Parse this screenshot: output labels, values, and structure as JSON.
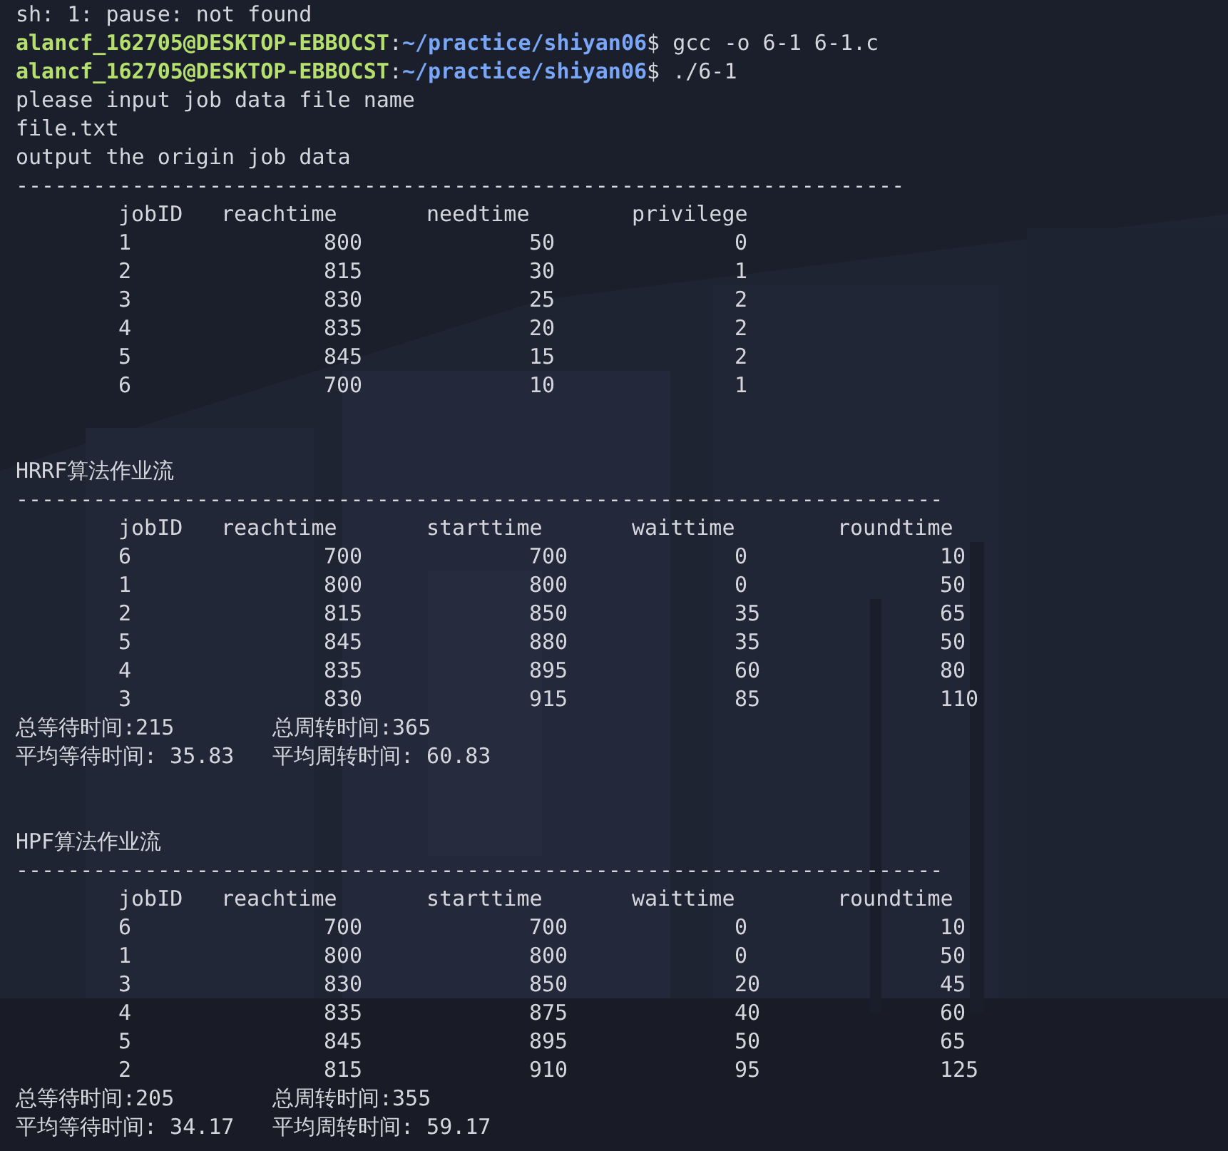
{
  "terminal": {
    "lines": [
      {
        "kind": "text",
        "text": "sh: 1: pause: not found"
      },
      {
        "kind": "prompt",
        "user": "alancf_162705@DESKTOP-EBBOCST",
        "sep": ":",
        "path": "~/practice/shiyan06",
        "command": "$ gcc -o 6-1 6-1.c"
      },
      {
        "kind": "prompt",
        "user": "alancf_162705@DESKTOP-EBBOCST",
        "sep": ":",
        "path": "~/practice/shiyan06",
        "command": "$ ./6-1"
      },
      {
        "kind": "text",
        "text": "please input job data file name"
      },
      {
        "kind": "text",
        "text": "file.txt"
      },
      {
        "kind": "text",
        "text": "output the origin job data"
      },
      {
        "kind": "rule",
        "text": "---------------------------------------------------------------------"
      },
      {
        "kind": "header",
        "cells": [
          "jobID",
          "reachtime",
          "needtime",
          "privilege"
        ]
      },
      {
        "kind": "row",
        "cells": [
          "1",
          "800",
          "50",
          "0"
        ]
      },
      {
        "kind": "row",
        "cells": [
          "2",
          "815",
          "30",
          "1"
        ]
      },
      {
        "kind": "row",
        "cells": [
          "3",
          "830",
          "25",
          "2"
        ]
      },
      {
        "kind": "row",
        "cells": [
          "4",
          "835",
          "20",
          "2"
        ]
      },
      {
        "kind": "row",
        "cells": [
          "5",
          "845",
          "15",
          "2"
        ]
      },
      {
        "kind": "row",
        "cells": [
          "6",
          "700",
          "10",
          "1"
        ]
      },
      {
        "kind": "blank"
      },
      {
        "kind": "blank"
      },
      {
        "kind": "text",
        "text": "HRRF算法作业流"
      },
      {
        "kind": "rule",
        "text": "------------------------------------------------------------------------"
      },
      {
        "kind": "header",
        "cells": [
          "jobID",
          "reachtime",
          "starttime",
          "waittime",
          "roundtime"
        ]
      },
      {
        "kind": "row",
        "cells": [
          "6",
          "700",
          "700",
          "0",
          "10"
        ]
      },
      {
        "kind": "row",
        "cells": [
          "1",
          "800",
          "800",
          "0",
          "50"
        ]
      },
      {
        "kind": "row",
        "cells": [
          "2",
          "815",
          "850",
          "35",
          "65"
        ]
      },
      {
        "kind": "row",
        "cells": [
          "5",
          "845",
          "880",
          "35",
          "50"
        ]
      },
      {
        "kind": "row",
        "cells": [
          "4",
          "835",
          "895",
          "60",
          "80"
        ]
      },
      {
        "kind": "row",
        "cells": [
          "3",
          "830",
          "915",
          "85",
          "110"
        ]
      },
      {
        "kind": "pair",
        "cells": [
          "总等待时间:215",
          "总周转时间:365"
        ]
      },
      {
        "kind": "pair",
        "cells": [
          "平均等待时间: 35.83",
          "平均周转时间: 60.83"
        ]
      },
      {
        "kind": "blank"
      },
      {
        "kind": "blank"
      },
      {
        "kind": "text",
        "text": "HPF算法作业流"
      },
      {
        "kind": "rule",
        "text": "------------------------------------------------------------------------"
      },
      {
        "kind": "header",
        "cells": [
          "jobID",
          "reachtime",
          "starttime",
          "waittime",
          "roundtime"
        ]
      },
      {
        "kind": "row",
        "cells": [
          "6",
          "700",
          "700",
          "0",
          "10"
        ]
      },
      {
        "kind": "row",
        "cells": [
          "1",
          "800",
          "800",
          "0",
          "50"
        ]
      },
      {
        "kind": "row",
        "cells": [
          "3",
          "830",
          "850",
          "20",
          "45"
        ]
      },
      {
        "kind": "row",
        "cells": [
          "4",
          "835",
          "875",
          "40",
          "60"
        ]
      },
      {
        "kind": "row",
        "cells": [
          "5",
          "845",
          "895",
          "50",
          "65"
        ]
      },
      {
        "kind": "row",
        "cells": [
          "2",
          "815",
          "910",
          "95",
          "125"
        ]
      },
      {
        "kind": "pair",
        "cells": [
          "总等待时间:205",
          "总周转时间:355"
        ]
      },
      {
        "kind": "pair",
        "cells": [
          "平均等待时间: 34.17",
          "平均周转时间: 59.17"
        ]
      }
    ]
  }
}
